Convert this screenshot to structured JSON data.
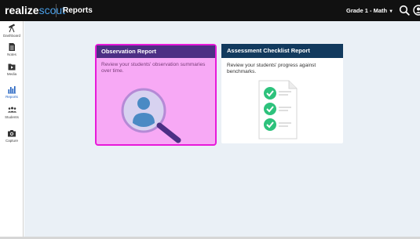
{
  "header": {
    "brand_main": "realize",
    "brand_sub": "scout",
    "app_title": "Reports",
    "grade_selector": "Grade 1 - Math",
    "search_icon": "search-icon",
    "account_icon": "account-icon"
  },
  "sidebar": {
    "items": [
      {
        "label": "Dashboard",
        "icon": "telescope-icon"
      },
      {
        "label": "Notes",
        "icon": "notes-icon"
      },
      {
        "label": "Media",
        "icon": "media-icon"
      },
      {
        "label": "Reports",
        "icon": "bar-chart-icon",
        "active": true
      },
      {
        "label": "Students",
        "icon": "students-icon"
      },
      {
        "label": "Capture",
        "icon": "camera-icon"
      }
    ]
  },
  "cards": [
    {
      "title": "Observation Report",
      "description": "Review your students' observation summaries over time.",
      "illustration": "magnifier-person-icon",
      "selected": true
    },
    {
      "title": "Assessment Checklist Report",
      "description": "Review your students' progress against benchmarks.",
      "illustration": "checklist-icon"
    }
  ],
  "colors": {
    "topbar": "#111111",
    "brand_accent": "#4a9fe8",
    "content_bg": "#eaf0f6",
    "card1_bg": "#f7a9f5",
    "card1_border": "#e81ad9",
    "card1_header": "#4c2f84",
    "card2_header": "#123a5e",
    "check_green": "#2dc27c"
  }
}
